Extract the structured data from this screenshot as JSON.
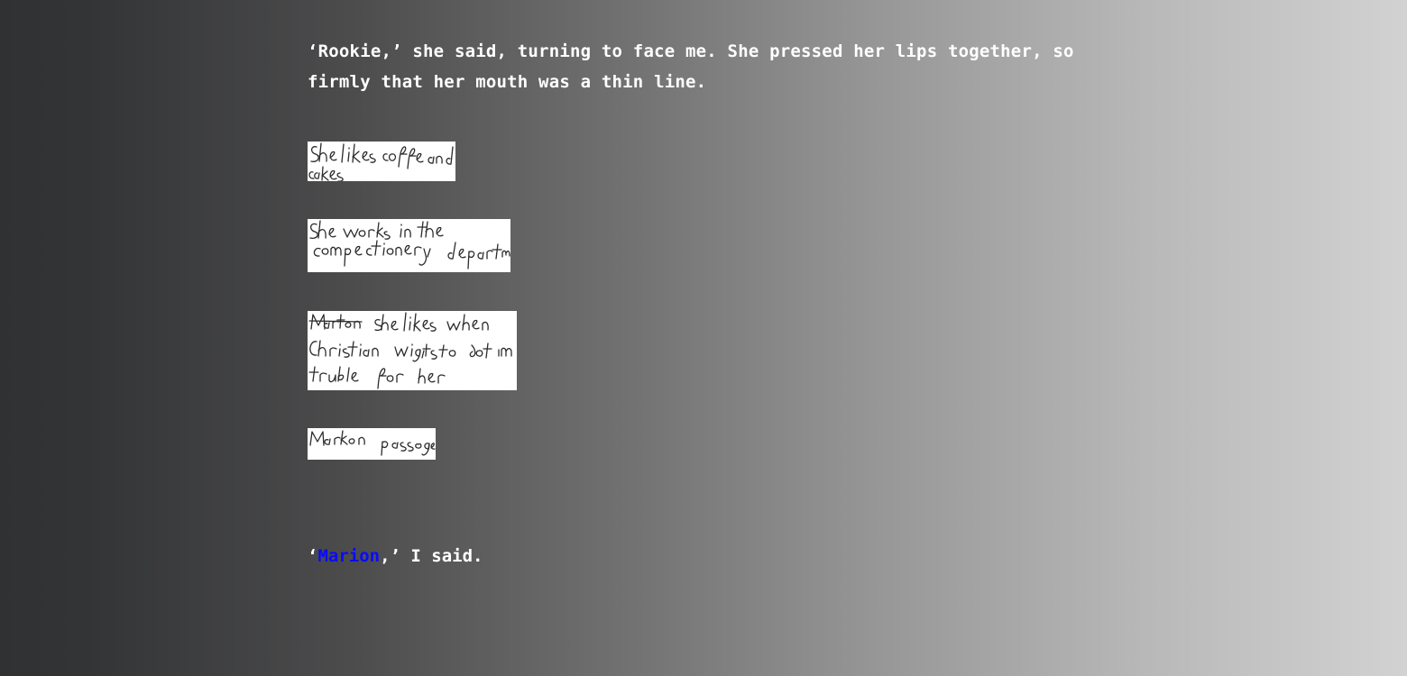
{
  "story": {
    "intro": "‘Rookie,’ she said, turning to face me. She pressed her lips together, so firmly that her mouth was a thin line.",
    "reply_open": "‘",
    "reply_name": "Marion",
    "reply_close": ",’ I said."
  },
  "notes": [
    {
      "text": "She likes coffee and cakes"
    },
    {
      "text": "She works in the confectionery department"
    },
    {
      "text": "Marion she likes when Christian wants to get in trouble for her"
    },
    {
      "text": "Marion passage"
    }
  ]
}
